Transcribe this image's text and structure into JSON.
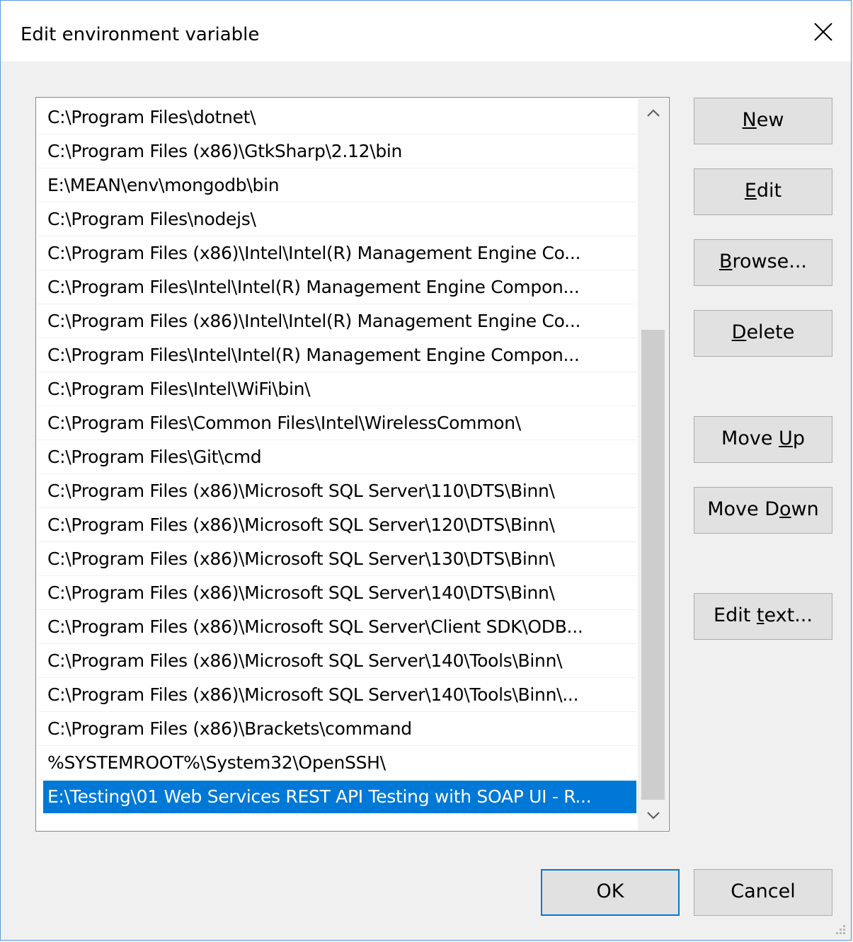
{
  "window": {
    "title": "Edit environment variable",
    "close_icon": "close-icon"
  },
  "list": {
    "items": [
      "C:\\Program Files\\dotnet\\",
      "C:\\Program Files (x86)\\GtkSharp\\2.12\\bin",
      "E:\\MEAN\\env\\mongodb\\bin",
      "C:\\Program Files\\nodejs\\",
      "C:\\Program Files (x86)\\Intel\\Intel(R) Management Engine Co...",
      "C:\\Program Files\\Intel\\Intel(R) Management Engine Compon...",
      "C:\\Program Files (x86)\\Intel\\Intel(R) Management Engine Co...",
      "C:\\Program Files\\Intel\\Intel(R) Management Engine Compon...",
      "C:\\Program Files\\Intel\\WiFi\\bin\\",
      "C:\\Program Files\\Common Files\\Intel\\WirelessCommon\\",
      "C:\\Program Files\\Git\\cmd",
      "C:\\Program Files (x86)\\Microsoft SQL Server\\110\\DTS\\Binn\\",
      "C:\\Program Files (x86)\\Microsoft SQL Server\\120\\DTS\\Binn\\",
      "C:\\Program Files (x86)\\Microsoft SQL Server\\130\\DTS\\Binn\\",
      "C:\\Program Files (x86)\\Microsoft SQL Server\\140\\DTS\\Binn\\",
      "C:\\Program Files (x86)\\Microsoft SQL Server\\Client SDK\\ODB...",
      "C:\\Program Files (x86)\\Microsoft SQL Server\\140\\Tools\\Binn\\",
      "C:\\Program Files (x86)\\Microsoft SQL Server\\140\\Tools\\Binn\\...",
      "C:\\Program Files (x86)\\Brackets\\command",
      "%SYSTEMROOT%\\System32\\OpenSSH\\",
      "E:\\Testing\\01 Web Services REST API Testing with SOAP UI - R..."
    ],
    "selected_index": 20
  },
  "buttons": {
    "new": {
      "pre": "",
      "ul": "N",
      "post": "ew"
    },
    "edit": {
      "pre": "",
      "ul": "E",
      "post": "dit"
    },
    "browse": {
      "pre": "",
      "ul": "B",
      "post": "rowse..."
    },
    "delete": {
      "pre": "",
      "ul": "D",
      "post": "elete"
    },
    "move_up": {
      "pre": "Move ",
      "ul": "U",
      "post": "p"
    },
    "move_down": {
      "pre": "Move D",
      "ul": "o",
      "post": "wn"
    },
    "edit_text": {
      "pre": "Edit ",
      "ul": "t",
      "post": "ext..."
    },
    "ok": "OK",
    "cancel": "Cancel"
  },
  "colors": {
    "selection": "#0078d7",
    "window_border": "#5b9bd5"
  }
}
